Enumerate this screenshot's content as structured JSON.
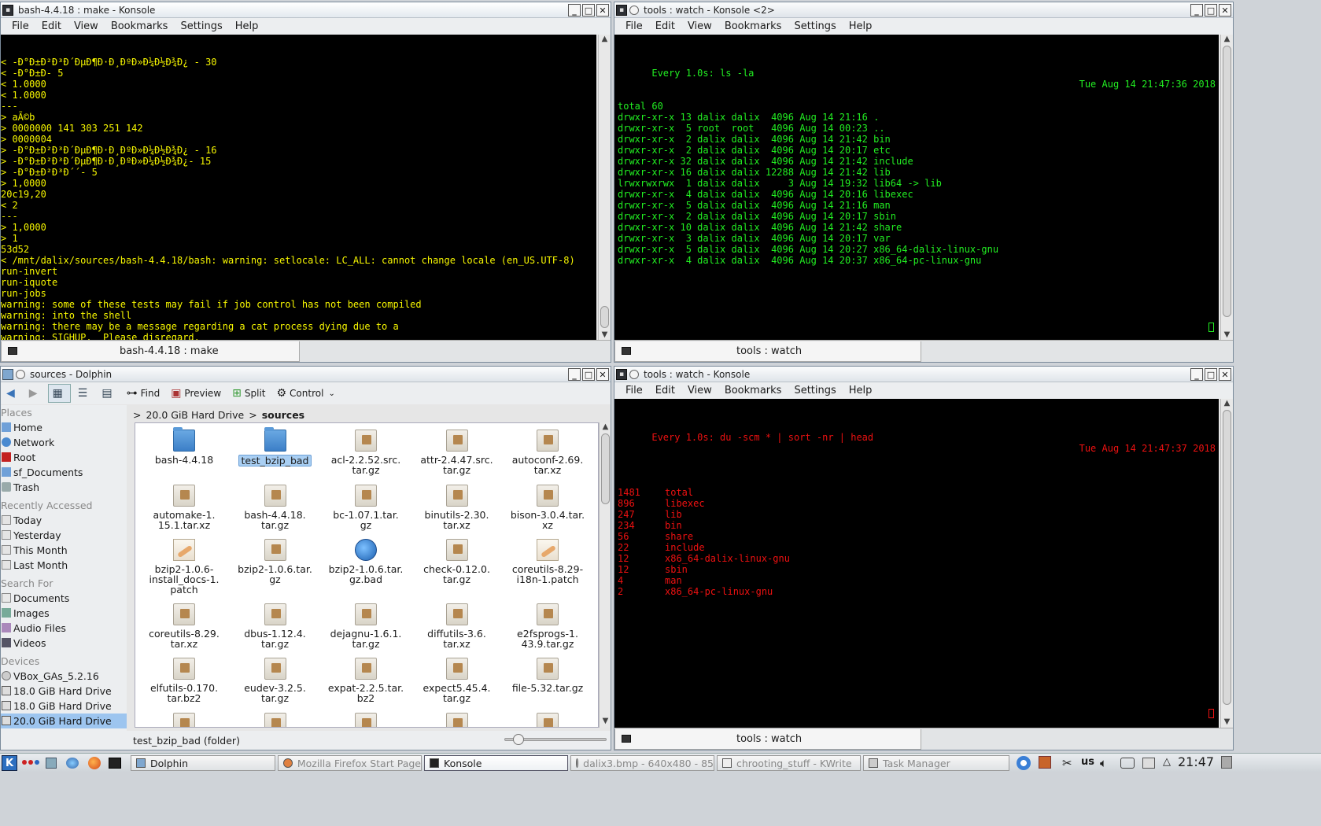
{
  "konsole1": {
    "title": "bash-4.4.18 : make - Konsole",
    "menu": [
      "File",
      "Edit",
      "View",
      "Bookmarks",
      "Settings",
      "Help"
    ],
    "lines": [
      "< -Ð°Ð±Ð²Ð³Ð´ÐµÐ¶Ð·Ð¸ÐºÐ»Ð¼Ð½Ð¾Ð¿ - 30",
      "< -Ð°Ð±Ð- 5",
      "< 1.0000",
      "< 1.0000",
      "---",
      "> aÃ©b",
      "> 0000000 141 303 251 142",
      "> 0000004",
      "> -Ð°Ð±Ð²Ð³Ð´ÐµÐ¶Ð·Ð¸ÐºÐ»Ð¼Ð½Ð¾Ð¿ - 16",
      "> -Ð°Ð±Ð²Ð³Ð´ÐµÐ¶Ð·Ð¸ÐºÐ»Ð¼Ð½Ð¾Ð¿- 15",
      "> -Ð°Ð±Ð²Ð³Ð´´- 5",
      "> 1,0000",
      "20c19,20",
      "< 2",
      "---",
      "> 1,0000",
      "> 1",
      "53d52",
      "< /mnt/dalix/sources/bash-4.4.18/bash: warning: setlocale: LC_ALL: cannot change locale (en_US.UTF-8)",
      "run-invert",
      "run-iquote",
      "run-jobs",
      "warning: some of these tests may fail if job control has not been compiled",
      "warning: into the shell",
      "warning: there may be a message regarding a cat process dying due to a",
      "warning: SIGHUP.  Please disregard."
    ],
    "tab_label": "bash-4.4.18 : make",
    "color": "#f7f700"
  },
  "konsole2": {
    "title": "tools : watch - Konsole <2>",
    "menu": [
      "File",
      "Edit",
      "View",
      "Bookmarks",
      "Settings",
      "Help"
    ],
    "header_left": "Every 1.0s: ls -la",
    "header_right": "Tue Aug 14 21:47:36 2018",
    "lines": [
      "",
      "total 60",
      "drwxr-xr-x 13 dalix dalix  4096 Aug 14 21:16 .",
      "drwxr-xr-x  5 root  root   4096 Aug 14 00:23 ..",
      "drwxr-xr-x  2 dalix dalix  4096 Aug 14 21:42 bin",
      "drwxr-xr-x  2 dalix dalix  4096 Aug 14 20:17 etc",
      "drwxr-xr-x 32 dalix dalix  4096 Aug 14 21:42 include",
      "drwxr-xr-x 16 dalix dalix 12288 Aug 14 21:42 lib",
      "lrwxrwxrwx  1 dalix dalix     3 Aug 14 19:32 lib64 -> lib",
      "drwxr-xr-x  4 dalix dalix  4096 Aug 14 20:16 libexec",
      "drwxr-xr-x  5 dalix dalix  4096 Aug 14 21:16 man",
      "drwxr-xr-x  2 dalix dalix  4096 Aug 14 20:17 sbin",
      "drwxr-xr-x 10 dalix dalix  4096 Aug 14 21:42 share",
      "drwxr-xr-x  3 dalix dalix  4096 Aug 14 20:17 var",
      "drwxr-xr-x  5 dalix dalix  4096 Aug 14 20:27 x86_64-dalix-linux-gnu",
      "drwxr-xr-x  4 dalix dalix  4096 Aug 14 20:37 x86_64-pc-linux-gnu"
    ],
    "tab_label": "tools : watch",
    "color": "#22ee22"
  },
  "konsole3": {
    "title": "tools : watch - Konsole",
    "menu": [
      "File",
      "Edit",
      "View",
      "Bookmarks",
      "Settings",
      "Help"
    ],
    "header_left": "Every 1.0s: du -scm * | sort -nr | head",
    "header_right": "Tue Aug 14 21:47:37 2018",
    "rows": [
      {
        "size": "1481",
        "name": "total"
      },
      {
        "size": "896",
        "name": "libexec"
      },
      {
        "size": "247",
        "name": "lib"
      },
      {
        "size": "234",
        "name": "bin"
      },
      {
        "size": "56",
        "name": "share"
      },
      {
        "size": "22",
        "name": "include"
      },
      {
        "size": "12",
        "name": "x86_64-dalix-linux-gnu"
      },
      {
        "size": "12",
        "name": "sbin"
      },
      {
        "size": "4",
        "name": "man"
      },
      {
        "size": "2",
        "name": "x86_64-pc-linux-gnu"
      }
    ],
    "tab_label": "tools : watch",
    "color": "#ee1111"
  },
  "dolphin": {
    "title": "sources - Dolphin",
    "toolbar": {
      "find": "Find",
      "preview": "Preview",
      "split": "Split",
      "control": "Control"
    },
    "places_head": "Places",
    "places": [
      "Home",
      "Network",
      "Root",
      "sf_Documents",
      "Trash"
    ],
    "recent_head": "Recently Accessed",
    "recent": [
      "Today",
      "Yesterday",
      "This Month",
      "Last Month"
    ],
    "search_head": "Search For",
    "search": [
      "Documents",
      "Images",
      "Audio Files",
      "Videos"
    ],
    "devices_head": "Devices",
    "devices": [
      "VBox_GAs_5.2.16",
      "18.0 GiB Hard Drive",
      "18.0 GiB Hard Drive",
      "20.0 GiB Hard Drive"
    ],
    "breadcrumb": {
      "drive": "20.0 GiB Hard Drive",
      "folder": "sources"
    },
    "files": [
      {
        "l1": "bash-4.4.18",
        "l2": "",
        "l3": "",
        "icon": "folder"
      },
      {
        "l1": "test_bzip_bad",
        "l2": "",
        "l3": "",
        "icon": "folder",
        "selected": true
      },
      {
        "l1": "acl-2.2.52.src.",
        "l2": "tar.gz",
        "l3": "",
        "icon": "pkg"
      },
      {
        "l1": "attr-2.4.47.src.",
        "l2": "tar.gz",
        "l3": "",
        "icon": "pkg"
      },
      {
        "l1": "autoconf-2.69.",
        "l2": "tar.xz",
        "l3": "",
        "icon": "pkg"
      },
      {
        "l1": "automake-1.",
        "l2": "15.1.tar.xz",
        "l3": "",
        "icon": "pkg"
      },
      {
        "l1": "bash-4.4.18.",
        "l2": "tar.gz",
        "l3": "",
        "icon": "pkg"
      },
      {
        "l1": "bc-1.07.1.tar.",
        "l2": "gz",
        "l3": "",
        "icon": "pkg"
      },
      {
        "l1": "binutils-2.30.",
        "l2": "tar.xz",
        "l3": "",
        "icon": "pkg"
      },
      {
        "l1": "bison-3.0.4.tar.",
        "l2": "xz",
        "l3": "",
        "icon": "pkg"
      },
      {
        "l1": "bzip2-1.0.6-",
        "l2": "install_docs-1.",
        "l3": "patch",
        "icon": "patch"
      },
      {
        "l1": "bzip2-1.0.6.tar.",
        "l2": "gz",
        "l3": "",
        "icon": "pkg"
      },
      {
        "l1": "bzip2-1.0.6.tar.",
        "l2": "gz.bad",
        "l3": "",
        "icon": "globe"
      },
      {
        "l1": "check-0.12.0.",
        "l2": "tar.gz",
        "l3": "",
        "icon": "pkg"
      },
      {
        "l1": "coreutils-8.29-",
        "l2": "i18n-1.patch",
        "l3": "",
        "icon": "patch"
      },
      {
        "l1": "coreutils-8.29.",
        "l2": "tar.xz",
        "l3": "",
        "icon": "pkg"
      },
      {
        "l1": "dbus-1.12.4.",
        "l2": "tar.gz",
        "l3": "",
        "icon": "pkg"
      },
      {
        "l1": "dejagnu-1.6.1.",
        "l2": "tar.gz",
        "l3": "",
        "icon": "pkg"
      },
      {
        "l1": "diffutils-3.6.",
        "l2": "tar.xz",
        "l3": "",
        "icon": "pkg"
      },
      {
        "l1": "e2fsprogs-1.",
        "l2": "43.9.tar.gz",
        "l3": "",
        "icon": "pkg"
      },
      {
        "l1": "elfutils-0.170.",
        "l2": "tar.bz2",
        "l3": "",
        "icon": "pkg"
      },
      {
        "l1": "eudev-3.2.5.",
        "l2": "tar.gz",
        "l3": "",
        "icon": "pkg"
      },
      {
        "l1": "expat-2.2.5.tar.",
        "l2": "bz2",
        "l3": "",
        "icon": "pkg"
      },
      {
        "l1": "expect5.45.4.",
        "l2": "tar.gz",
        "l3": "",
        "icon": "pkg"
      },
      {
        "l1": "file-5.32.tar.gz",
        "l2": "",
        "l3": "",
        "icon": "pkg"
      }
    ],
    "status": "test_bzip_bad (folder)"
  },
  "taskbar": {
    "tasks": [
      "Dolphin",
      "Mozilla Firefox Start Page",
      "Konsole",
      "dalix3.bmp - 640x480 - 85",
      "chrooting_stuff - KWrite",
      "Task Manager"
    ],
    "layout": "us",
    "clock": "21:47"
  }
}
